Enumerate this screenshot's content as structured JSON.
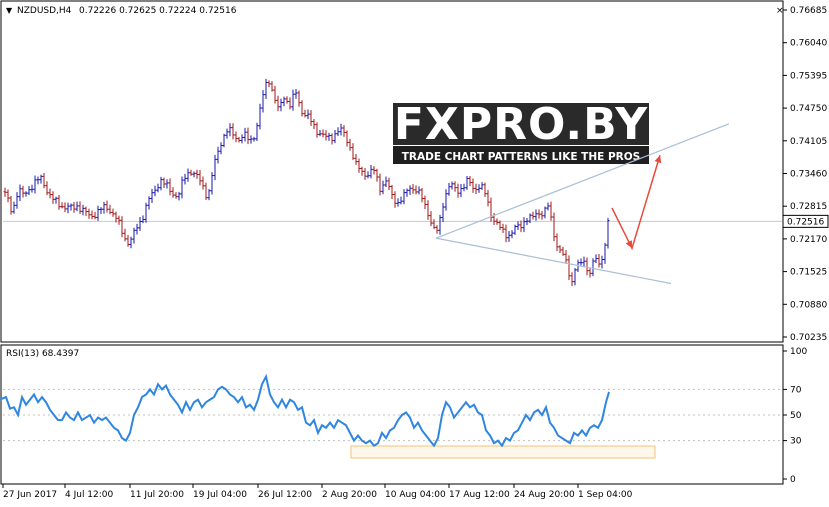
{
  "header": {
    "symbol_text": "NZDUSD,H4",
    "ohlc_text": "0.72226 0.72625 0.72224 0.72516"
  },
  "watermark": {
    "logo_text": "FXPRO.BY",
    "tagline": "TRADE CHART PATTERNS LIKE THE PROS"
  },
  "colors": {
    "bull": "#1a1aa8",
    "bear": "#a01818",
    "rsi": "#2f86e0",
    "trendline": "#a9bfd6",
    "arrow": "#e84a3a",
    "oversold_box": "#f5c27a",
    "current_price_line": "#bfc9d6"
  },
  "chart_data": [
    {
      "type": "candlestick",
      "symbol": "NZDUSD",
      "timeframe": "H4",
      "last_price": 0.72516,
      "last_price_label": "0.72516",
      "ylim": [
        0.70235,
        0.76685
      ],
      "yticks": [
        "0.76685",
        "0.76040",
        "0.75395",
        "0.74750",
        "0.74105",
        "0.73460",
        "0.72815",
        "0.72170",
        "0.71525",
        "0.70880",
        "0.70235"
      ],
      "x_tick_labels": [
        "27 Jun 2017",
        "4 Jul 12:00",
        "11 Jul 20:00",
        "19 Jul 04:00",
        "26 Jul 12:00",
        "2 Aug 20:00",
        "10 Aug 04:00",
        "17 Aug 12:00",
        "24 Aug 20:00",
        "1 Sep 04:00"
      ],
      "close_path": [
        [
          0,
          0.733
        ],
        [
          6,
          0.73
        ],
        [
          12,
          0.727
        ],
        [
          18,
          0.7315
        ],
        [
          24,
          0.73
        ],
        [
          30,
          0.732
        ],
        [
          36,
          0.733
        ],
        [
          42,
          0.7335
        ],
        [
          48,
          0.731
        ],
        [
          54,
          0.729
        ],
        [
          60,
          0.7285
        ],
        [
          66,
          0.728
        ],
        [
          72,
          0.7275
        ],
        [
          78,
          0.7285
        ],
        [
          84,
          0.727
        ],
        [
          90,
          0.726
        ],
        [
          96,
          0.727
        ],
        [
          102,
          0.7275
        ],
        [
          108,
          0.728
        ],
        [
          114,
          0.7265
        ],
        [
          120,
          0.724
        ],
        [
          126,
          0.7215
        ],
        [
          130,
          0.721
        ],
        [
          136,
          0.7235
        ],
        [
          142,
          0.726
        ],
        [
          148,
          0.729
        ],
        [
          154,
          0.731
        ],
        [
          160,
          0.7335
        ],
        [
          166,
          0.732
        ],
        [
          172,
          0.731
        ],
        [
          178,
          0.73
        ],
        [
          184,
          0.7335
        ],
        [
          190,
          0.7355
        ],
        [
          196,
          0.734
        ],
        [
          202,
          0.7325
        ],
        [
          208,
          0.73
        ],
        [
          214,
          0.736
        ],
        [
          220,
          0.7405
        ],
        [
          226,
          0.743
        ],
        [
          232,
          0.7425
        ],
        [
          238,
          0.7415
        ],
        [
          244,
          0.742
        ],
        [
          250,
          0.741
        ],
        [
          256,
          0.743
        ],
        [
          262,
          0.749
        ],
        [
          268,
          0.754
        ],
        [
          272,
          0.751
        ],
        [
          278,
          0.747
        ],
        [
          284,
          0.75
        ],
        [
          290,
          0.748
        ],
        [
          296,
          0.7505
        ],
        [
          302,
          0.747
        ],
        [
          308,
          0.7455
        ],
        [
          314,
          0.744
        ],
        [
          320,
          0.7425
        ],
        [
          326,
          0.7415
        ],
        [
          332,
          0.742
        ],
        [
          338,
          0.743
        ],
        [
          344,
          0.7425
        ],
        [
          350,
          0.74
        ],
        [
          356,
          0.736
        ],
        [
          362,
          0.735
        ],
        [
          368,
          0.7345
        ],
        [
          374,
          0.735
        ],
        [
          380,
          0.732
        ],
        [
          386,
          0.733
        ],
        [
          392,
          0.73
        ],
        [
          398,
          0.729
        ],
        [
          404,
          0.73
        ],
        [
          410,
          0.732
        ],
        [
          416,
          0.7315
        ],
        [
          422,
          0.7295
        ],
        [
          428,
          0.727
        ],
        [
          434,
          0.7235
        ],
        [
          438,
          0.723
        ],
        [
          444,
          0.73
        ],
        [
          450,
          0.7325
        ],
        [
          456,
          0.731
        ],
        [
          462,
          0.732
        ],
        [
          468,
          0.733
        ],
        [
          474,
          0.7315
        ],
        [
          480,
          0.7325
        ],
        [
          486,
          0.73
        ],
        [
          490,
          0.727
        ],
        [
          496,
          0.725
        ],
        [
          502,
          0.723
        ],
        [
          508,
          0.7225
        ],
        [
          514,
          0.7235
        ],
        [
          520,
          0.724
        ],
        [
          526,
          0.726
        ],
        [
          532,
          0.7255
        ],
        [
          538,
          0.727
        ],
        [
          544,
          0.727
        ],
        [
          548,
          0.728
        ],
        [
          552,
          0.7245
        ],
        [
          556,
          0.721
        ],
        [
          560,
          0.7195
        ],
        [
          564,
          0.718
        ],
        [
          568,
          0.7155
        ],
        [
          572,
          0.7135
        ],
        [
          576,
          0.717
        ],
        [
          580,
          0.716
        ],
        [
          584,
          0.7175
        ],
        [
          588,
          0.715
        ],
        [
          592,
          0.7165
        ],
        [
          596,
          0.7175
        ],
        [
          600,
          0.716
        ],
        [
          604,
          0.72
        ],
        [
          608,
          0.725
        ],
        [
          610,
          0.7252
        ]
      ],
      "annotations": {
        "upper_trendline": {
          "from": [
            436,
            0.72185
          ],
          "to": [
            729,
            0.7444
          ]
        },
        "lower_trendline": {
          "from": [
            436,
            0.72185
          ],
          "to": [
            671,
            0.7129
          ]
        },
        "arrow_path": [
          [
            612,
            0.7278
          ],
          [
            632,
            0.71985
          ],
          [
            660,
            0.7382
          ]
        ]
      }
    },
    {
      "type": "line",
      "title": "RSI(13) 68.4397",
      "ylim": [
        0,
        100
      ],
      "yticks": [
        "100",
        "70",
        "50",
        "30",
        "0"
      ],
      "oversold_zone_label": "",
      "series": [
        {
          "name": "RSI(13)",
          "values": [
            [
              0,
              62
            ],
            [
              6,
              64
            ],
            [
              10,
              55
            ],
            [
              14,
              56
            ],
            [
              18,
              50
            ],
            [
              22,
              64
            ],
            [
              26,
              58
            ],
            [
              30,
              62
            ],
            [
              34,
              66
            ],
            [
              38,
              60
            ],
            [
              42,
              64
            ],
            [
              46,
              60
            ],
            [
              50,
              54
            ],
            [
              54,
              50
            ],
            [
              58,
              46
            ],
            [
              62,
              46
            ],
            [
              66,
              52
            ],
            [
              70,
              48
            ],
            [
              74,
              46
            ],
            [
              78,
              52
            ],
            [
              82,
              46
            ],
            [
              86,
              48
            ],
            [
              90,
              50
            ],
            [
              94,
              44
            ],
            [
              98,
              48
            ],
            [
              102,
              46
            ],
            [
              106,
              48
            ],
            [
              110,
              44
            ],
            [
              114,
              40
            ],
            [
              118,
              38
            ],
            [
              122,
              32
            ],
            [
              126,
              30
            ],
            [
              130,
              36
            ],
            [
              134,
              50
            ],
            [
              138,
              56
            ],
            [
              142,
              64
            ],
            [
              146,
              66
            ],
            [
              150,
              70
            ],
            [
              154,
              66
            ],
            [
              158,
              74
            ],
            [
              162,
              70
            ],
            [
              166,
              73
            ],
            [
              170,
              66
            ],
            [
              174,
              62
            ],
            [
              178,
              58
            ],
            [
              182,
              52
            ],
            [
              186,
              60
            ],
            [
              190,
              54
            ],
            [
              194,
              60
            ],
            [
              198,
              62
            ],
            [
              202,
              56
            ],
            [
              206,
              60
            ],
            [
              210,
              62
            ],
            [
              214,
              64
            ],
            [
              218,
              70
            ],
            [
              222,
              72
            ],
            [
              226,
              70
            ],
            [
              230,
              66
            ],
            [
              234,
              64
            ],
            [
              238,
              60
            ],
            [
              242,
              64
            ],
            [
              246,
              56
            ],
            [
              250,
              58
            ],
            [
              254,
              54
            ],
            [
              258,
              62
            ],
            [
              262,
              74
            ],
            [
              266,
              80
            ],
            [
              270,
              66
            ],
            [
              274,
              60
            ],
            [
              278,
              56
            ],
            [
              282,
              62
            ],
            [
              286,
              56
            ],
            [
              290,
              62
            ],
            [
              294,
              60
            ],
            [
              298,
              54
            ],
            [
              302,
              56
            ],
            [
              306,
              44
            ],
            [
              310,
              42
            ],
            [
              314,
              46
            ],
            [
              318,
              36
            ],
            [
              322,
              42
            ],
            [
              326,
              40
            ],
            [
              330,
              44
            ],
            [
              334,
              40
            ],
            [
              338,
              46
            ],
            [
              342,
              44
            ],
            [
              346,
              42
            ],
            [
              350,
              36
            ],
            [
              354,
              30
            ],
            [
              358,
              34
            ],
            [
              362,
              30
            ],
            [
              366,
              28
            ],
            [
              370,
              30
            ],
            [
              374,
              26
            ],
            [
              378,
              28
            ],
            [
              382,
              36
            ],
            [
              386,
              32
            ],
            [
              390,
              38
            ],
            [
              394,
              40
            ],
            [
              398,
              46
            ],
            [
              402,
              50
            ],
            [
              406,
              52
            ],
            [
              410,
              48
            ],
            [
              414,
              40
            ],
            [
              418,
              44
            ],
            [
              422,
              38
            ],
            [
              426,
              34
            ],
            [
              430,
              30
            ],
            [
              434,
              26
            ],
            [
              438,
              32
            ],
            [
              442,
              50
            ],
            [
              446,
              60
            ],
            [
              450,
              56
            ],
            [
              454,
              48
            ],
            [
              458,
              52
            ],
            [
              462,
              56
            ],
            [
              466,
              60
            ],
            [
              470,
              56
            ],
            [
              474,
              58
            ],
            [
              478,
              52
            ],
            [
              482,
              50
            ],
            [
              486,
              38
            ],
            [
              490,
              34
            ],
            [
              494,
              28
            ],
            [
              498,
              30
            ],
            [
              502,
              26
            ],
            [
              506,
              32
            ],
            [
              510,
              30
            ],
            [
              514,
              36
            ],
            [
              518,
              38
            ],
            [
              522,
              44
            ],
            [
              526,
              50
            ],
            [
              530,
              46
            ],
            [
              534,
              52
            ],
            [
              538,
              54
            ],
            [
              542,
              50
            ],
            [
              546,
              56
            ],
            [
              550,
              44
            ],
            [
              554,
              40
            ],
            [
              558,
              34
            ],
            [
              562,
              32
            ],
            [
              566,
              30
            ],
            [
              570,
              28
            ],
            [
              574,
              36
            ],
            [
              578,
              34
            ],
            [
              582,
              38
            ],
            [
              586,
              34
            ],
            [
              590,
              40
            ],
            [
              594,
              42
            ],
            [
              598,
              40
            ],
            [
              602,
              46
            ],
            [
              606,
              60
            ],
            [
              609,
              68
            ]
          ]
        }
      ],
      "x_tick_labels": [
        "27 Jun 2017",
        "4 Jul 12:00",
        "11 Jul 20:00",
        "19 Jul 04:00",
        "26 Jul 12:00",
        "2 Aug 20:00",
        "10 Aug 04:00",
        "17 Aug 12:00",
        "24 Aug 20:00",
        "1 Sep 04:00"
      ]
    }
  ]
}
